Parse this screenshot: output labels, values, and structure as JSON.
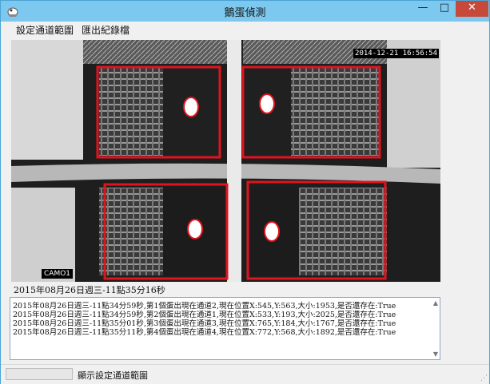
{
  "window": {
    "title": "鵝蛋偵測",
    "min_glyph": "—",
    "max_glyph": "□",
    "close_glyph": "✕"
  },
  "menu": {
    "items": [
      "設定通道範圍",
      "匯出紀錄檔"
    ]
  },
  "camera": {
    "timestamp": "2014-12-21 16:56:54",
    "label": "CAMO1"
  },
  "status": {
    "current_time": "2015年08月26日週三-11點35分16秒",
    "bar_text": "顯示設定通道範圍",
    "progress": 0
  },
  "log": {
    "lines": [
      "2015年08月26日週三-11點34分59秒,第1個蛋出現在通道2,現在位置X:545,Y:563,大小:1953,是否還存在:True",
      "2015年08月26日週三-11點34分59秒,第2個蛋出現在通道1,現在位置X:533,Y:193,大小:2025,是否還存在:True",
      "2015年08月26日週三-11點35分01秒,第3個蛋出現在通道3,現在位置X:765,Y:184,大小:1767,是否還存在:True",
      "2015年08月26日週三-11點35分11秒,第4個蛋出現在通道4,現在位置X:772,Y:568,大小:1892,是否還存在:True"
    ]
  },
  "colors": {
    "detection_box": "#e0141e",
    "titlebar": "#7cc8ef",
    "close": "#c7493a"
  }
}
